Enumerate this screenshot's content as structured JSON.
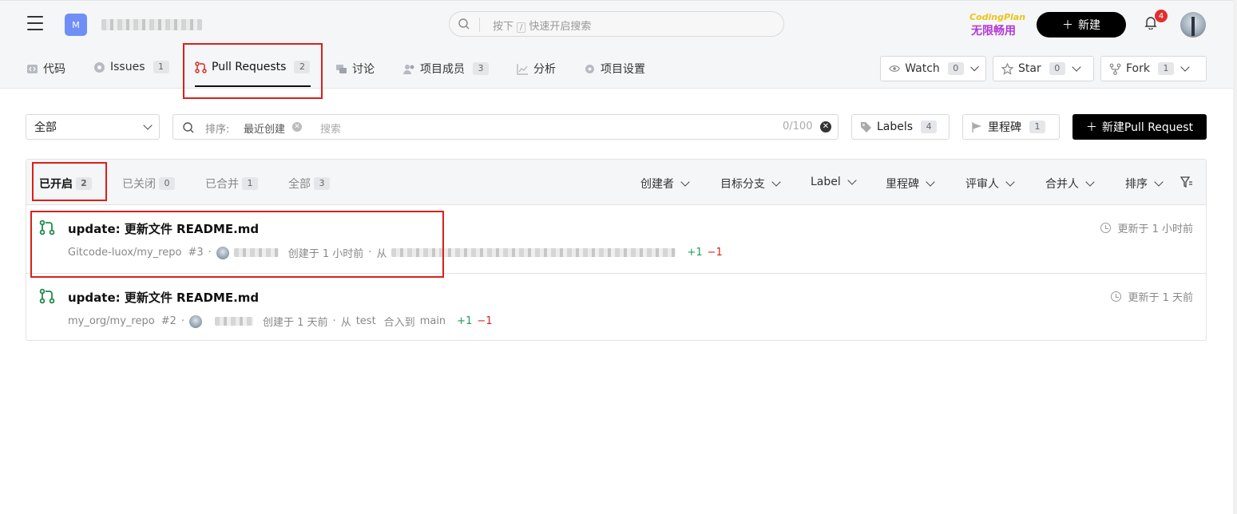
{
  "project": {
    "avatar_letter": "M"
  },
  "search": {
    "prefix": "按下",
    "key": "/",
    "placeholder": "快速开启搜索"
  },
  "promo": {
    "line1": "CodingPlan",
    "line2": "无限畅用"
  },
  "header": {
    "new_button": "新建",
    "notification_count": "4"
  },
  "nav": {
    "tabs": [
      {
        "label": "代码",
        "count": ""
      },
      {
        "label": "Issues",
        "count": "1"
      },
      {
        "label": "Pull Requests",
        "count": "2"
      },
      {
        "label": "讨论",
        "count": ""
      },
      {
        "label": "项目成员",
        "count": "3"
      },
      {
        "label": "分析",
        "count": ""
      },
      {
        "label": "项目设置",
        "count": ""
      }
    ],
    "watch": {
      "label": "Watch",
      "count": "0"
    },
    "star": {
      "label": "Star",
      "count": "0"
    },
    "fork": {
      "label": "Fork",
      "count": "1"
    }
  },
  "filters": {
    "scope": "全部",
    "sort_label": "排序:",
    "sort_value": "最近创建",
    "search_placeholder": "搜索",
    "char_count": "0/100",
    "labels": {
      "label": "Labels",
      "count": "4"
    },
    "milestones": {
      "label": "里程碑",
      "count": "1"
    },
    "new_pr": "新建Pull Request"
  },
  "state_tabs": [
    {
      "label": "已开启",
      "count": "2"
    },
    {
      "label": "已关闭",
      "count": "0"
    },
    {
      "label": "已合并",
      "count": "1"
    },
    {
      "label": "全部",
      "count": "3"
    }
  ],
  "dropdowns": [
    "创建者",
    "目标分支",
    "Label",
    "里程碑",
    "评审人",
    "合并人",
    "排序"
  ],
  "pull_requests": [
    {
      "title": "update: 更新文件 README.md",
      "repo": "Gitcode-luox/my_repo",
      "number": "#3",
      "created": "创建于 1 小时前",
      "from_label": "从",
      "additions": "+1",
      "deletions": "−1",
      "updated": "更新于 1 小时前"
    },
    {
      "title": "update: 更新文件 README.md",
      "repo": "my_org/my_repo",
      "number": "#2",
      "created": "创建于 1 天前",
      "from_label": "从",
      "branch": "test",
      "merge_label": "合入到",
      "target": "main",
      "additions": "+1",
      "deletions": "−1",
      "updated": "更新于 1 天前"
    }
  ],
  "colors": {
    "accent": "#000000",
    "highlight": "#d9201c",
    "add": "#1f9d55",
    "del": "#d9201c",
    "pr_icon": "#1f8a4c"
  }
}
